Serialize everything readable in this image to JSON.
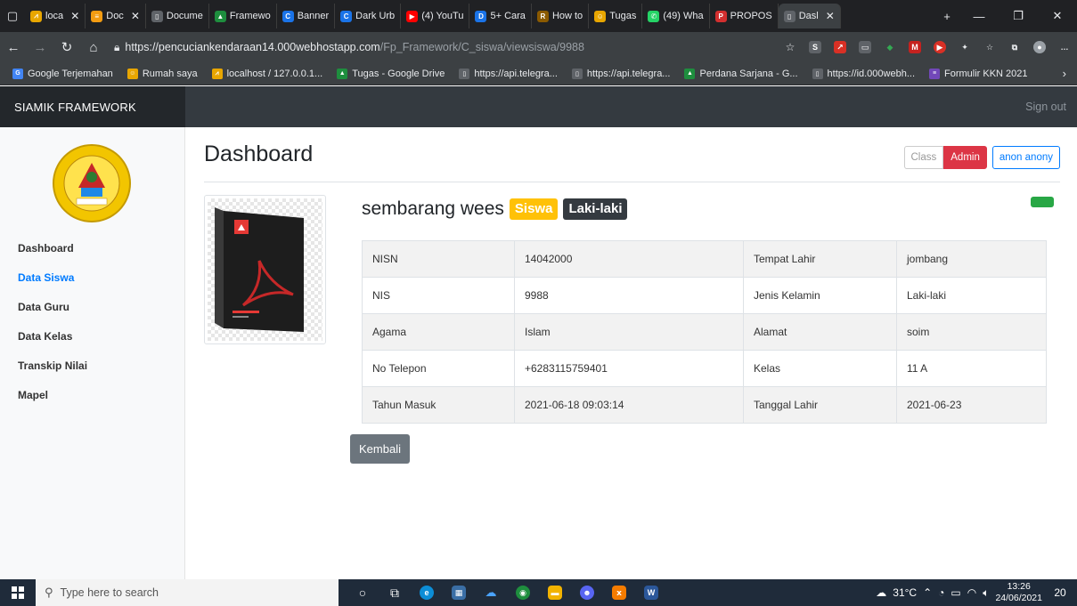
{
  "browser": {
    "tabs": [
      {
        "title": "loca",
        "fav_color": "#e8a600",
        "fav_glyph": "⩘"
      },
      {
        "title": "Doc",
        "fav_color": "#f39c12",
        "fav_glyph": "≡"
      },
      {
        "title": "Docume",
        "fav_color": "#5f6368",
        "fav_glyph": "▯"
      },
      {
        "title": "Framewo",
        "fav_color": "#1e8e3e",
        "fav_glyph": "▲"
      },
      {
        "title": "Banner",
        "fav_color": "#1a73e8",
        "fav_glyph": "C"
      },
      {
        "title": "Dark Urb",
        "fav_color": "#1a73e8",
        "fav_glyph": "C"
      },
      {
        "title": "(4) YouTu",
        "fav_color": "#ff0000",
        "fav_glyph": "▶"
      },
      {
        "title": "5+ Cara",
        "fav_color": "#1a73e8",
        "fav_glyph": "D"
      },
      {
        "title": "How to",
        "fav_color": "#8b5a00",
        "fav_glyph": "R"
      },
      {
        "title": "Tugas",
        "fav_color": "#e8a600",
        "fav_glyph": "☺"
      },
      {
        "title": "(49) Wha",
        "fav_color": "#25d366",
        "fav_glyph": "✆"
      },
      {
        "title": "PROPOS",
        "fav_color": "#d32f2f",
        "fav_glyph": "P"
      },
      {
        "title": "Dasl",
        "fav_color": "#5f6368",
        "fav_glyph": "▯"
      }
    ],
    "url_host": "https://pencuciankendaraan14.000webhostapp.com",
    "url_path": "/Fp_Framework/C_siswa/viewsiswa/9988",
    "bookmarks": [
      {
        "label": "Google Terjemahan",
        "fav_color": "#4285f4",
        "fav_glyph": "G"
      },
      {
        "label": "Rumah saya",
        "fav_color": "#e8a600",
        "fav_glyph": "☺"
      },
      {
        "label": "localhost / 127.0.0.1...",
        "fav_color": "#e8a600",
        "fav_glyph": "⩘"
      },
      {
        "label": "Tugas - Google Drive",
        "fav_color": "#1e8e3e",
        "fav_glyph": "▲"
      },
      {
        "label": "https://api.telegra...",
        "fav_color": "#5f6368",
        "fav_glyph": "▯"
      },
      {
        "label": "https://api.telegra...",
        "fav_color": "#5f6368",
        "fav_glyph": "▯"
      },
      {
        "label": "Perdana Sarjana - G...",
        "fav_color": "#1e8e3e",
        "fav_glyph": "▲"
      },
      {
        "label": "https://id.000webh...",
        "fav_color": "#5f6368",
        "fav_glyph": "▯"
      },
      {
        "label": "Formulir KKN 2021",
        "fav_color": "#7248b9",
        "fav_glyph": "≡"
      }
    ]
  },
  "app": {
    "brand": "SIAMIK FRAMEWORK",
    "signout": "Sign out",
    "sidebar": [
      {
        "label": "Dashboard",
        "active": false
      },
      {
        "label": "Data Siswa",
        "active": true
      },
      {
        "label": "Data Guru",
        "active": false
      },
      {
        "label": "Data Kelas",
        "active": false
      },
      {
        "label": "Transkip Nilai",
        "active": false
      },
      {
        "label": "Mapel",
        "active": false
      }
    ],
    "page_title": "Dashboard",
    "toolbar": {
      "class_label": "Class",
      "admin_label": "Admin",
      "user_label": "anon anony"
    },
    "student": {
      "name": "sembarang wees",
      "role_badge": "Siswa",
      "gender_badge": "Laki-laki"
    },
    "table": [
      [
        "NISN",
        "14042000",
        "Tempat Lahir",
        "jombang"
      ],
      [
        "NIS",
        "9988",
        "Jenis Kelamin",
        "Laki-laki"
      ],
      [
        "Agama",
        "Islam",
        "Alamat",
        "soim"
      ],
      [
        "No Telepon",
        "+6283115759401",
        "Kelas",
        "11 A"
      ],
      [
        "Tahun Masuk",
        "2021-06-18 09:03:14",
        "Tanggal Lahir",
        "2021-06-23"
      ]
    ],
    "back_label": "Kembali",
    "colors": {
      "primary": "#007bff",
      "danger": "#dc3545",
      "warning": "#ffc107",
      "success": "#28a745",
      "navbar": "#343a40"
    }
  },
  "taskbar": {
    "search_placeholder": "Type here to search",
    "weather": "31°C",
    "time": "13:26",
    "date": "24/06/2021",
    "notifications": "20"
  }
}
